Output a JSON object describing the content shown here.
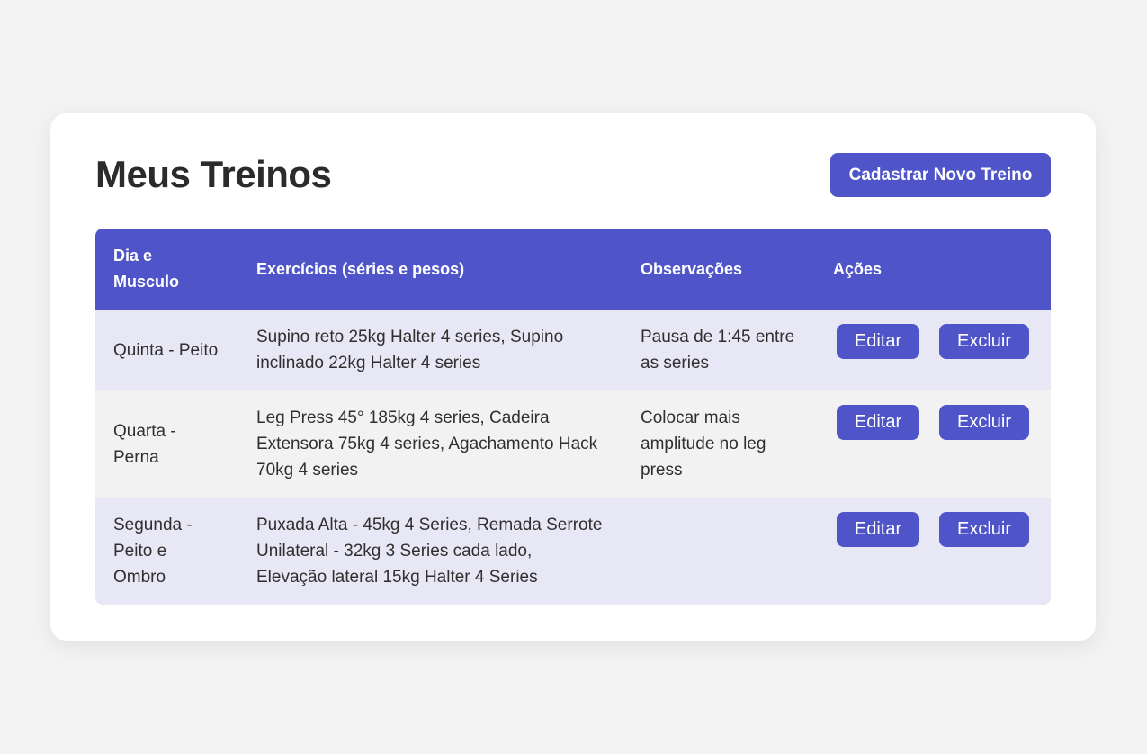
{
  "page": {
    "title": "Meus Treinos",
    "new_button_label": "Cadastrar Novo Treino"
  },
  "table": {
    "headers": [
      "Dia e Musculo",
      "Exercícios (séries e pesos)",
      "Observações",
      "Ações"
    ],
    "rows": [
      {
        "dia": "Quinta - Peito",
        "exercicios": "Supino reto 25kg Halter 4 series, Supino inclinado 22kg Halter 4 series",
        "observacoes": "Pausa de 1:45 entre as series",
        "edit_label": "Editar",
        "delete_label": "Excluir"
      },
      {
        "dia": "Quarta - Perna",
        "exercicios": "Leg Press 45° 185kg 4 series, Cadeira Extensora 75kg 4 series, Agachamento Hack 70kg 4 series",
        "observacoes": "Colocar mais amplitude no leg press",
        "edit_label": "Editar",
        "delete_label": "Excluir"
      },
      {
        "dia": "Segunda - Peito e Ombro",
        "exercicios": "Puxada Alta - 45kg 4 Series, Remada Serrote Unilateral - 32kg 3 Series cada lado, Elevação lateral 15kg Halter 4 Series",
        "observacoes": "",
        "edit_label": "Editar",
        "delete_label": "Excluir"
      }
    ]
  },
  "colors": {
    "accent": "#4f55c9",
    "row_odd": "#e8e7f5",
    "row_even": "#f2f2f2",
    "background": "#f3f3f3"
  }
}
